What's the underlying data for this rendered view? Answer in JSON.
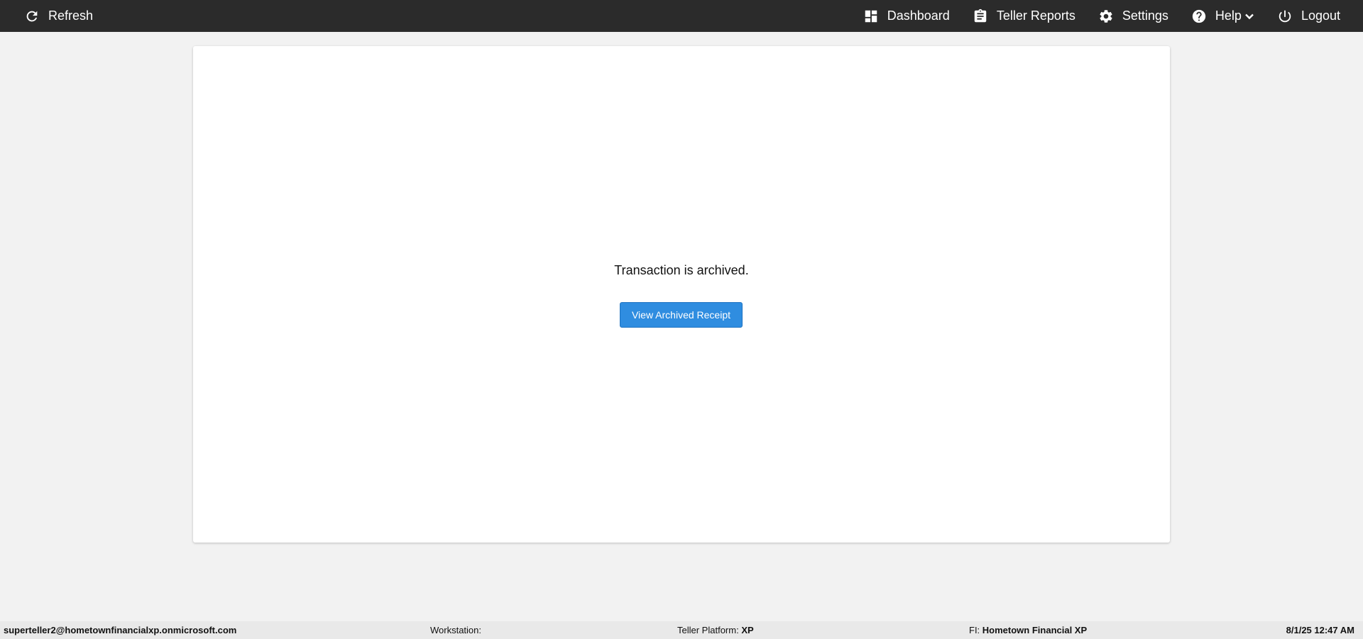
{
  "topbar": {
    "refresh_label": "Refresh",
    "nav": {
      "dashboard": "Dashboard",
      "teller_reports": "Teller Reports",
      "settings": "Settings",
      "help": "Help",
      "logout": "Logout"
    }
  },
  "main": {
    "message": "Transaction is archived.",
    "view_button": "View Archived Receipt"
  },
  "status": {
    "user": "superteller2@hometownfinancialxp.onmicrosoft.com",
    "workstation_label": "Workstation:",
    "workstation_value": "",
    "teller_platform_label": "Teller Platform:",
    "teller_platform_value": "XP",
    "fi_label": "FI:",
    "fi_value": "Hometown Financial XP",
    "datetime": "8/1/25 12:47 AM"
  },
  "colors": {
    "topbar_bg": "#2b2b2b",
    "primary_button": "#2f8de0",
    "page_bg": "#f2f2f2"
  }
}
